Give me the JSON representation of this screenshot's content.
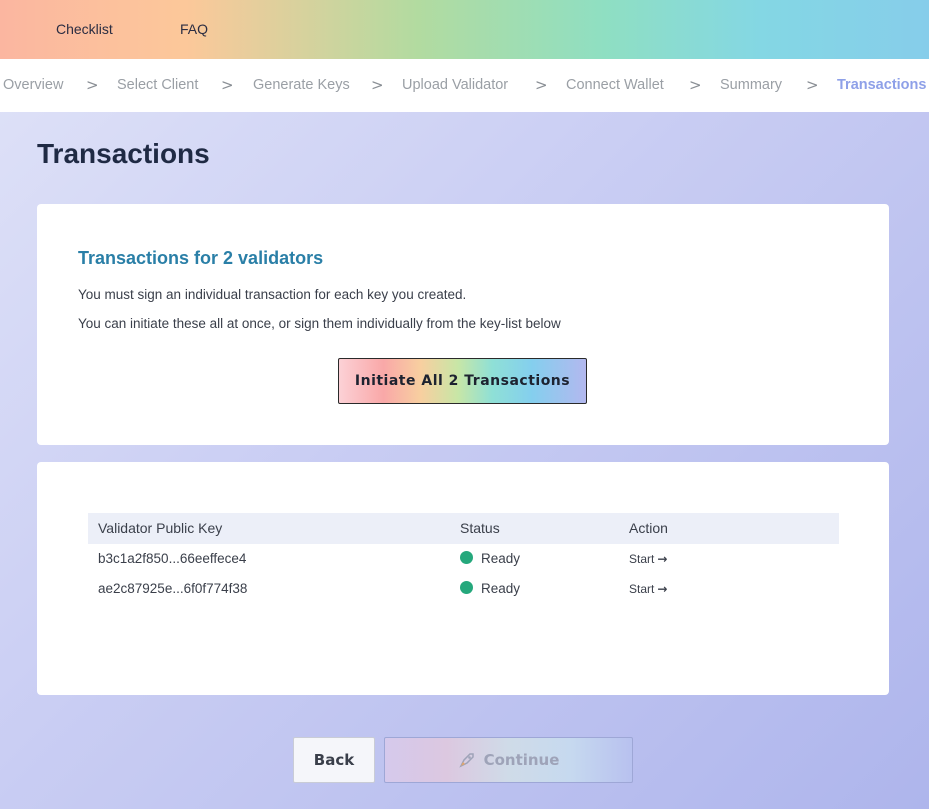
{
  "topnav": {
    "checklist": "Checklist",
    "faq": "FAQ"
  },
  "steps": {
    "overview": "Overview",
    "select_client": "Select Client",
    "generate_keys": "Generate Keys",
    "upload_validator": "Upload Validator",
    "connect_wallet": "Connect Wallet",
    "summary": "Summary",
    "transactions": "Transactions",
    "separator": ">"
  },
  "page": {
    "title": "Transactions"
  },
  "intro_card": {
    "heading": "Transactions for 2 validators",
    "line1": "You must sign an individual transaction for each key you created.",
    "line2": "You can initiate these all at once, or sign them individually from the key-list below",
    "initiate_button": "Initiate All 2 Transactions"
  },
  "table": {
    "headers": {
      "key": "Validator Public Key",
      "status": "Status",
      "action": "Action"
    },
    "rows": [
      {
        "key": "b3c1a2f850...66eeffece4",
        "status": "Ready",
        "action": "Start"
      },
      {
        "key": "ae2c87925e...6f0f774f38",
        "status": "Ready",
        "action": "Start"
      }
    ]
  },
  "footer": {
    "back_label": "Back",
    "continue_label": "Continue"
  },
  "colors": {
    "ready_status": "#25a87c",
    "active_step": "#8ea0e8",
    "heading_blue": "#2a7fa7"
  },
  "icons": {
    "step_separator": "chevron-right-icon",
    "start_arrow": "arrow-right-icon",
    "continue_icon": "rocket-icon",
    "status": "status-dot-icon"
  }
}
